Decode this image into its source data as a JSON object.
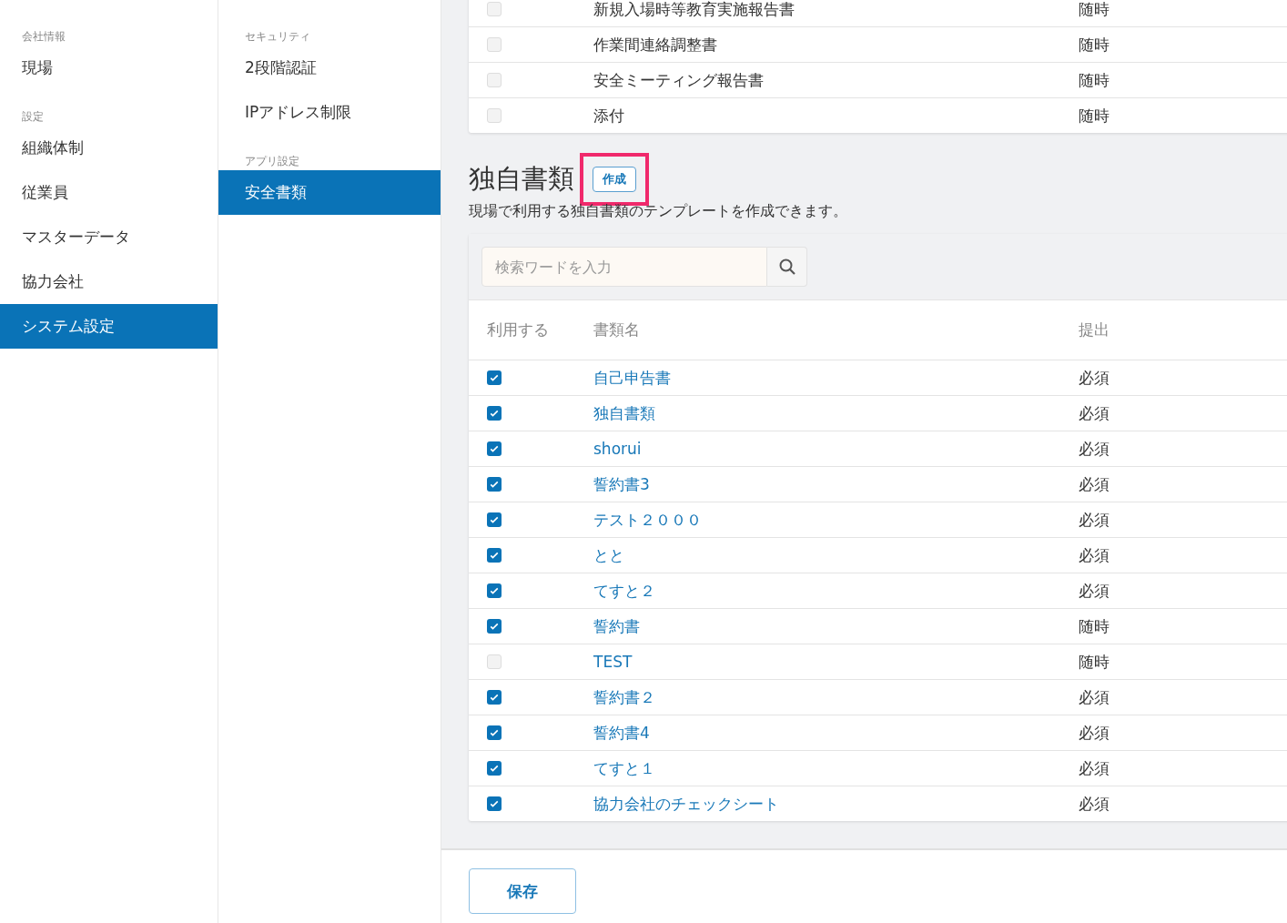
{
  "sidebar": {
    "sections": [
      {
        "heading": "会社情報",
        "items": [
          {
            "label": "現場",
            "selected": false
          }
        ]
      },
      {
        "heading": "設定",
        "items": [
          {
            "label": "組織体制",
            "selected": false
          },
          {
            "label": "従業員",
            "selected": false
          },
          {
            "label": "マスターデータ",
            "selected": false
          },
          {
            "label": "協力会社",
            "selected": false
          },
          {
            "label": "システム設定",
            "selected": true
          }
        ]
      }
    ]
  },
  "subnav": {
    "sections": [
      {
        "heading": "セキュリティ",
        "items": [
          {
            "label": "2段階認証",
            "selected": false
          },
          {
            "label": "IPアドレス制限",
            "selected": false
          }
        ]
      },
      {
        "heading": "アプリ設定",
        "items": [
          {
            "label": "安全書類",
            "selected": true
          }
        ]
      }
    ]
  },
  "standard_documents": {
    "rows": [
      {
        "checked": false,
        "name": "新規入場時等教育実施報告書",
        "submission": "随時"
      },
      {
        "checked": false,
        "name": "作業間連絡調整書",
        "submission": "随時"
      },
      {
        "checked": false,
        "name": "安全ミーティング報告書",
        "submission": "随時"
      },
      {
        "checked": false,
        "name": "添付",
        "submission": "随時"
      }
    ]
  },
  "custom_documents": {
    "title": "独自書類",
    "create_button": {
      "label": "作成",
      "highlighted": true
    },
    "description": "現場で利用する独自書類のテンプレートを作成できます。",
    "search": {
      "placeholder": "検索ワードを入力"
    },
    "columns": [
      "利用する",
      "書類名",
      "提出"
    ],
    "rows": [
      {
        "checked": true,
        "name": "自己申告書",
        "submission": "必須"
      },
      {
        "checked": true,
        "name": "独自書類",
        "submission": "必須"
      },
      {
        "checked": true,
        "name": "shorui",
        "submission": "必須"
      },
      {
        "checked": true,
        "name": "誓約書3",
        "submission": "必須"
      },
      {
        "checked": true,
        "name": "テスト２０００",
        "submission": "必須"
      },
      {
        "checked": true,
        "name": "とと",
        "submission": "必須"
      },
      {
        "checked": true,
        "name": "てすと２",
        "submission": "必須"
      },
      {
        "checked": true,
        "name": "誓約書",
        "submission": "随時"
      },
      {
        "checked": false,
        "name": "TEST",
        "submission": "随時"
      },
      {
        "checked": true,
        "name": "誓約書２",
        "submission": "必須"
      },
      {
        "checked": true,
        "name": "誓約書4",
        "submission": "必須"
      },
      {
        "checked": true,
        "name": "てすと１",
        "submission": "必須"
      },
      {
        "checked": true,
        "name": "協力会社のチェックシート",
        "submission": "必須"
      }
    ]
  },
  "save_button": {
    "label": "保存"
  }
}
